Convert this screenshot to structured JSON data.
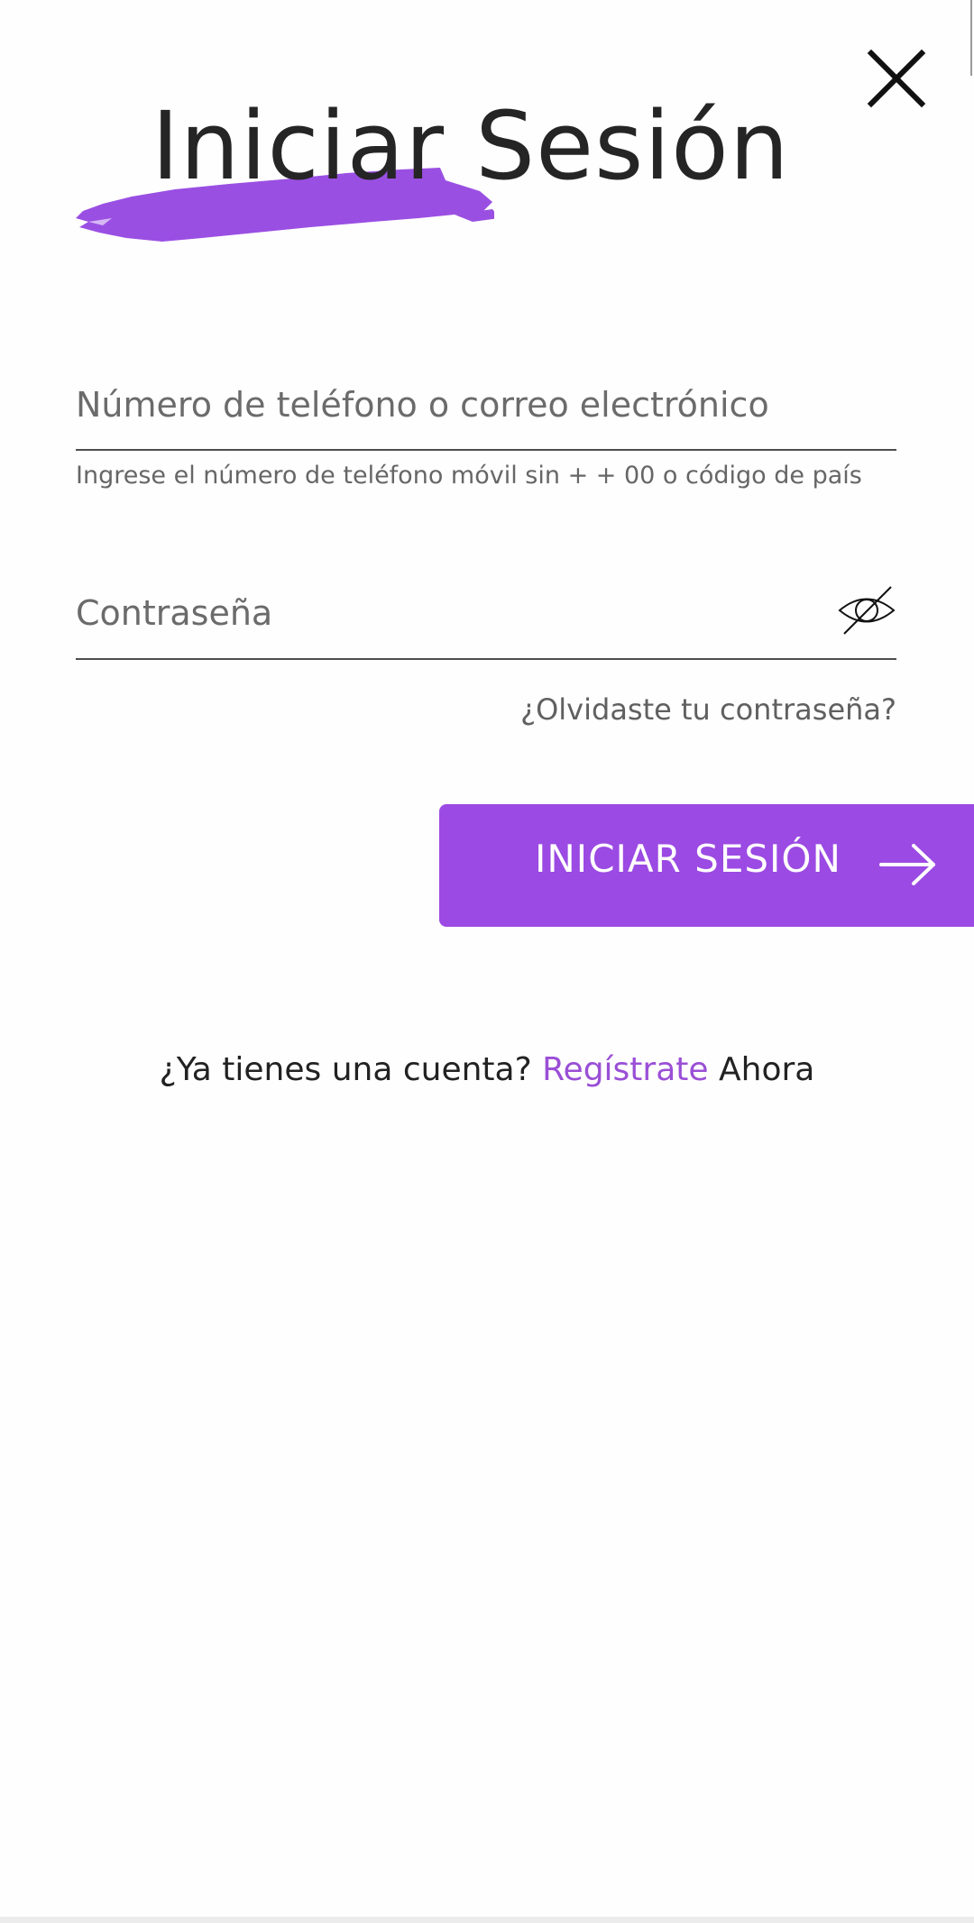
{
  "header": {
    "title": "Iniciar Sesión",
    "close_icon": "close-icon"
  },
  "form": {
    "phone_placeholder": "Número de teléfono o correo electrónico",
    "phone_value": "",
    "phone_helper": "Ingrese el número de teléfono móvil sin + + 00 o código de país",
    "password_placeholder": "Contraseña",
    "password_value": "",
    "visibility_icon": "eye-off-icon",
    "forgot_label": "¿Olvidaste tu contraseña?",
    "submit_label": "INICIAR SESIÓN",
    "submit_icon": "arrow-right-icon"
  },
  "signup": {
    "prompt": "¿Ya tienes una cuenta?",
    "link_label": "Regístrate",
    "suffix": "Ahora"
  },
  "colors": {
    "accent": "#9b4ae3",
    "link": "#9a4fd6",
    "text_dark": "#252525",
    "text_muted": "#666666",
    "background": "#fefefe"
  }
}
